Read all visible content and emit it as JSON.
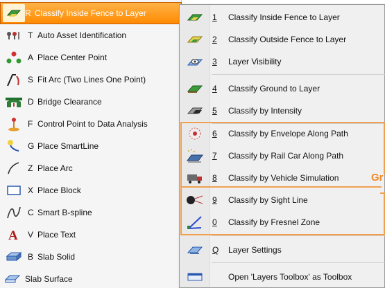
{
  "left_menu": {
    "items": [
      {
        "key": "R",
        "label": "Classify Inside Fence to Layer",
        "icon": "classify-fence-icon",
        "selected": true
      },
      {
        "key": "T",
        "label": "Auto Asset Identification",
        "icon": "asset-id-icon"
      },
      {
        "key": "A",
        "label": "Place Center Point",
        "icon": "center-point-icon"
      },
      {
        "key": "S",
        "label": "Fit Arc (Two Lines One Point)",
        "icon": "fit-arc-icon"
      },
      {
        "key": "D",
        "label": "Bridge Clearance",
        "icon": "bridge-icon"
      },
      {
        "key": "F",
        "label": "Control Point to Data Analysis",
        "icon": "control-point-icon"
      },
      {
        "key": "G",
        "label": "Place SmartLine",
        "icon": "smartline-icon"
      },
      {
        "key": "Z",
        "label": "Place Arc",
        "icon": "arc-icon"
      },
      {
        "key": "X",
        "label": "Place Block",
        "icon": "block-icon"
      },
      {
        "key": "C",
        "label": "Smart B-spline",
        "icon": "bspline-icon"
      },
      {
        "key": "V",
        "label": "Place Text",
        "icon": "text-icon"
      },
      {
        "key": "B",
        "label": "Slab Solid",
        "icon": "slab-solid-icon"
      },
      {
        "key": "",
        "label": "Slab Surface",
        "icon": "slab-surface-icon"
      }
    ]
  },
  "submenu": {
    "items": [
      {
        "key": "1",
        "label": "Classify Inside Fence to Layer",
        "icon": "classify-inside-icon"
      },
      {
        "key": "2",
        "label": "Classify Outside Fence to Layer",
        "icon": "classify-outside-icon"
      },
      {
        "key": "3",
        "label": "Layer Visibility",
        "icon": "layer-visibility-icon"
      },
      {
        "key": "4",
        "label": "Classify Ground to Layer",
        "icon": "classify-ground-icon"
      },
      {
        "key": "5",
        "label": "Classify by Intensity",
        "icon": "classify-intensity-icon"
      },
      {
        "key": "6",
        "label": "Classify by Envelope Along Path",
        "icon": "envelope-path-icon"
      },
      {
        "key": "7",
        "label": "Classify by Rail Car Along Path",
        "icon": "rail-car-icon"
      },
      {
        "key": "8",
        "label": "Classify by Vehicle Simulation",
        "icon": "vehicle-icon"
      },
      {
        "key": "9",
        "label": "Classify by Sight Line",
        "icon": "sight-line-icon"
      },
      {
        "key": "0",
        "label": "Classify by Fresnel Zone",
        "icon": "fresnel-icon"
      },
      {
        "key": "Q",
        "label": "Layer Settings",
        "icon": "layer-settings-icon"
      },
      {
        "key": "",
        "label": "Open 'Layers Toolbox' as Toolbox",
        "icon": "toolbox-icon"
      }
    ]
  },
  "highlight_label": "Gr",
  "colors": {
    "selected": "#ff9a1f",
    "highlight": "#f0a050"
  }
}
